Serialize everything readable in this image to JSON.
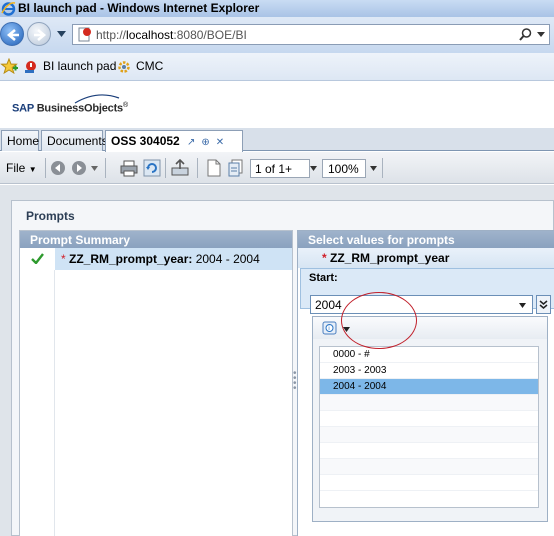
{
  "window": {
    "title": "BI launch pad - Windows Internet Explorer"
  },
  "address": {
    "url_prefix": "http://",
    "url_host": "localhost",
    "url_rest": ":8080/BOE/BI"
  },
  "favorites": [
    {
      "label": "BI launch pad",
      "icon": "bi-launchpad-icon"
    },
    {
      "label": "CMC",
      "icon": "cmc-icon"
    }
  ],
  "brand": {
    "sap": "SAP ",
    "bo": "BusinessObjects",
    "trademark": "®"
  },
  "tabs": [
    {
      "label": "Home"
    },
    {
      "label": "Documents"
    },
    {
      "label": "OSS 304052"
    }
  ],
  "toolbar": {
    "file_label": "File",
    "page": "1 of 1+",
    "zoom": "100%"
  },
  "prompts": {
    "title": "Prompts",
    "summary_header": "Prompt Summary",
    "summary_row": {
      "star": "*",
      "name": "ZZ_RM_prompt_year:",
      "value": " 2004 - 2004"
    },
    "values_header": "Select values for prompts",
    "prompt_name": "ZZ_RM_prompt_year",
    "start_label": "Start:",
    "start_value": "2004",
    "list_items": [
      "0000 - #",
      "2003 - 2003",
      "2004 - 2004"
    ],
    "selected_index": 2
  },
  "colors": {
    "accent": "#7db7e8",
    "header_bg": "#9fb3cb",
    "required_star": "#d0202a",
    "annotation": "#c0202b"
  }
}
